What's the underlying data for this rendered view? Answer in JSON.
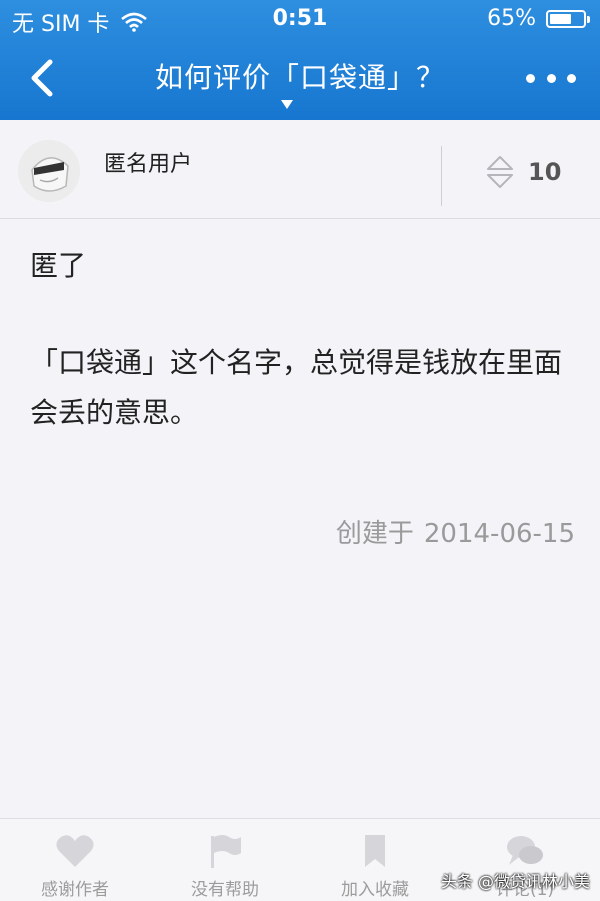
{
  "status_bar": {
    "carrier": "无 SIM 卡",
    "time": "0:51",
    "battery_percent_label": "65%",
    "battery_level": 0.65
  },
  "nav": {
    "title": "如何评价「口袋通」？",
    "back_icon": "chevron-left-icon",
    "more_icon": "more-icon"
  },
  "answer": {
    "author": "匿名用户",
    "avatar_icon": "anonymous-avatar-icon",
    "vote_icon": "vote-arrows-icon",
    "votes": "10",
    "paragraphs": [
      "匿了",
      "「口袋通」这个名字，总觉得是钱放在里面会丢的意思。"
    ],
    "created_label": "创建于",
    "created_date": "2014-06-15"
  },
  "bottom_tabs": [
    {
      "label": "感谢作者",
      "icon": "heart-icon"
    },
    {
      "label": "没有帮助",
      "icon": "flag-icon"
    },
    {
      "label": "加入收藏",
      "icon": "bookmark-icon"
    },
    {
      "label": "评论(1)",
      "icon": "comment-icon"
    }
  ],
  "watermark": "头条 @微贷讯林小美",
  "colors": {
    "header_blue": "#1e82d8",
    "background": "#f4f4f8",
    "muted_text": "#9a9a9a"
  }
}
